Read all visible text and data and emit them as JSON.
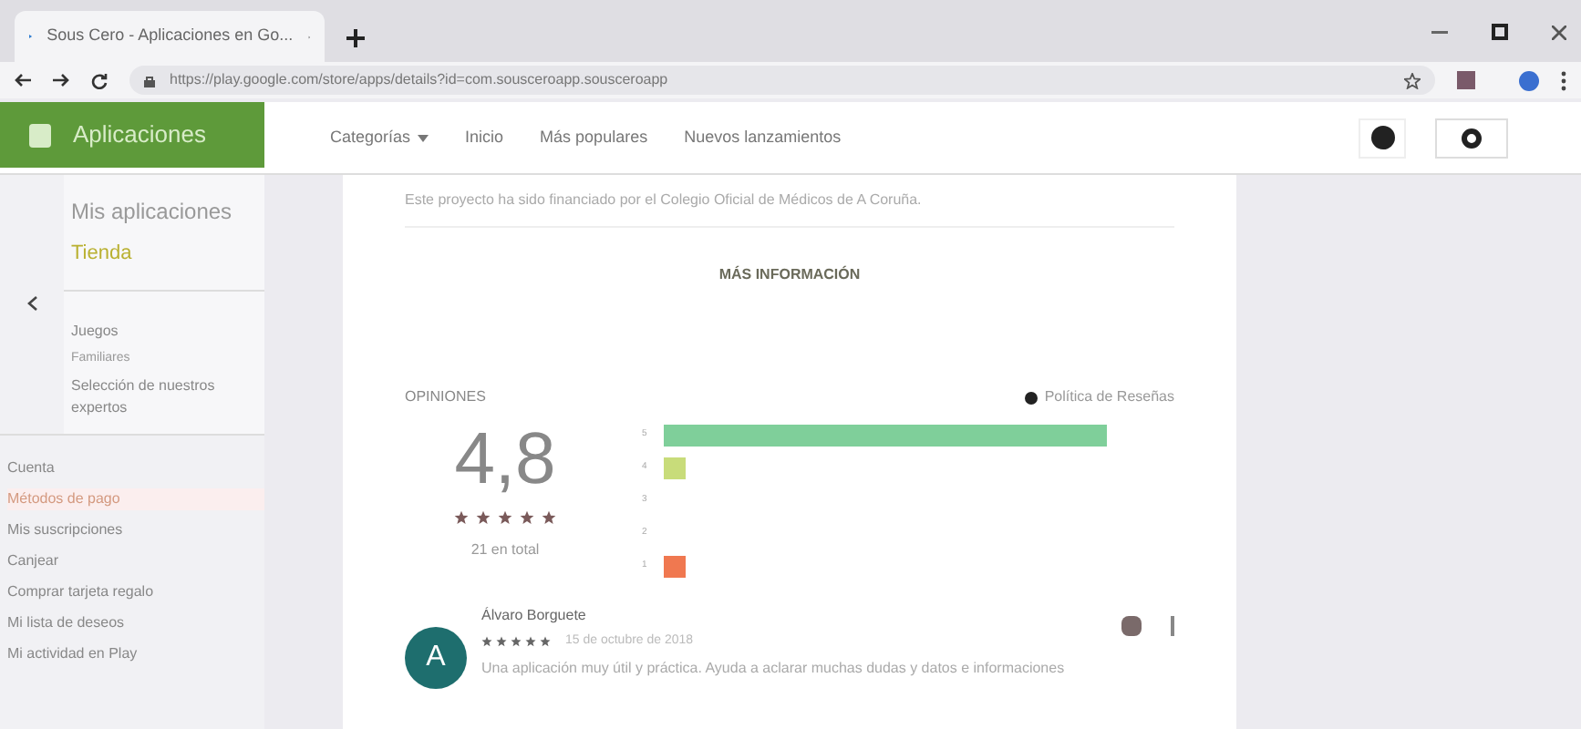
{
  "browser": {
    "tab_title": "Sous Cero - Aplicaciones en Go...",
    "url": "https://play.google.com/store/apps/details?id=com.sousceroapp.sousceroapp"
  },
  "header": {
    "brand": "Aplicaciones",
    "nav": [
      {
        "label": "Categorías",
        "dropdown": true
      },
      {
        "label": "Inicio",
        "dropdown": false
      },
      {
        "label": "Más populares",
        "dropdown": false
      },
      {
        "label": "Nuevos lanzamientos",
        "dropdown": false
      }
    ]
  },
  "sidebar": {
    "top": [
      {
        "label": "Mis aplicaciones",
        "selected": false
      },
      {
        "label": "Tienda",
        "selected": true
      }
    ],
    "sections": [
      {
        "label": "Juegos",
        "kind": "title"
      },
      {
        "label": "Familiares",
        "kind": "sub"
      },
      {
        "label": "Selección de nuestros expertos",
        "kind": "title"
      }
    ],
    "account": [
      {
        "label": "Cuenta",
        "selected": false
      },
      {
        "label": "Métodos de pago",
        "selected": true
      },
      {
        "label": "Mis suscripciones",
        "selected": false
      },
      {
        "label": "Canjear",
        "selected": false
      },
      {
        "label": "Comprar tarjeta regalo",
        "selected": false
      },
      {
        "label": "Mi lista de deseos",
        "selected": false
      },
      {
        "label": "Mi actividad en Play",
        "selected": false
      }
    ]
  },
  "content": {
    "description": "Este proyecto ha sido financiado por el Colegio Oficial de Médicos de A Coruña.",
    "more_button": "MÁS INFORMACIÓN",
    "reviews": {
      "title": "OPINIONES",
      "policy": "Política de Reseñas",
      "score": "4,8",
      "stars": 5,
      "total": "21 en total",
      "histogram": [
        {
          "label": "5",
          "color": "#7fcf9a"
        },
        {
          "label": "4",
          "color": "#c8dc7a"
        },
        {
          "label": "3"
        },
        {
          "label": "2"
        },
        {
          "label": "1",
          "color": "#f07850"
        }
      ],
      "items": [
        {
          "initial": "A",
          "author": "Álvaro Borguete",
          "stars": 5,
          "date": "15 de octubre de 2018",
          "text": "Una aplicación muy útil y práctica. Ayuda a aclarar muchas dudas y datos e informaciones"
        }
      ]
    }
  }
}
